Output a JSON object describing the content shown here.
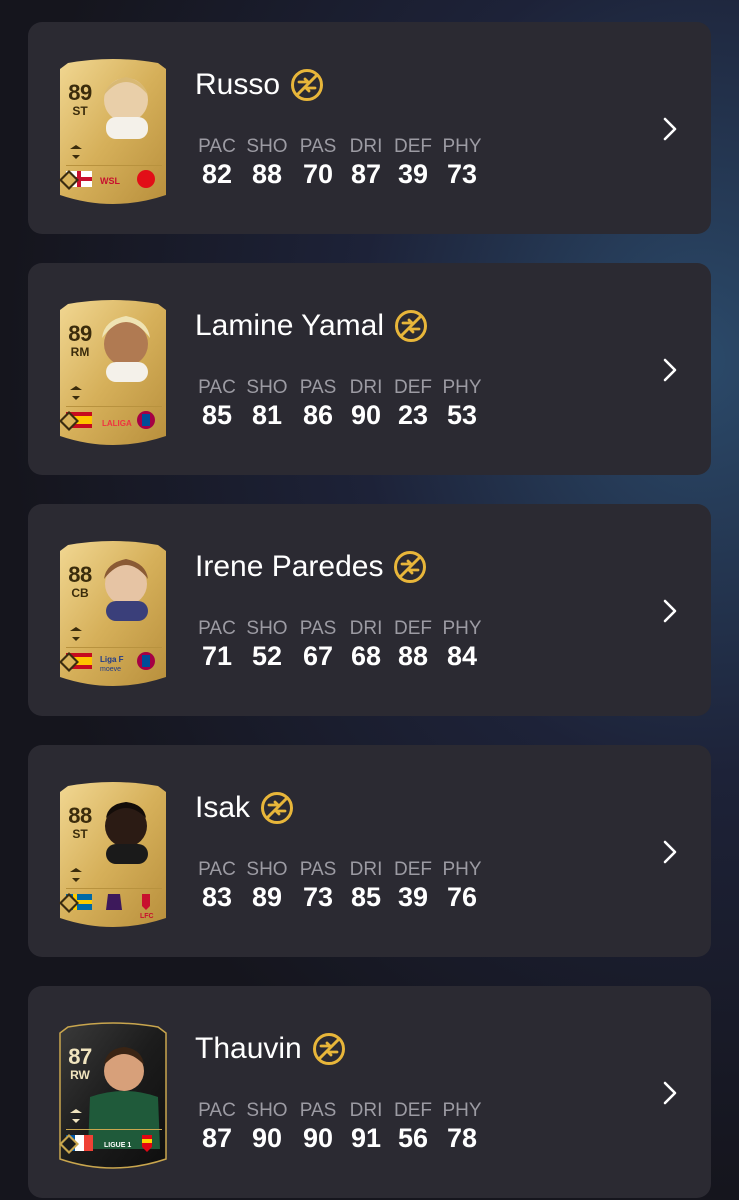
{
  "stat_labels": [
    "PAC",
    "SHO",
    "PAS",
    "DRI",
    "DEF",
    "PHY"
  ],
  "players": [
    {
      "name": "Russo",
      "rating": "89",
      "position": "ST",
      "stats": [
        "82",
        "88",
        "70",
        "87",
        "39",
        "73"
      ],
      "card": "gold",
      "nation_flag": "england-flag",
      "league_badge": "wsl-badge",
      "club_badge": "arsenal-badge"
    },
    {
      "name": "Lamine Yamal",
      "rating": "89",
      "position": "RM",
      "stats": [
        "85",
        "81",
        "86",
        "90",
        "23",
        "53"
      ],
      "card": "gold",
      "nation_flag": "spain-flag",
      "league_badge": "laliga-badge",
      "club_badge": "barcelona-badge"
    },
    {
      "name": "Irene Paredes",
      "rating": "88",
      "position": "CB",
      "stats": [
        "71",
        "52",
        "67",
        "68",
        "88",
        "84"
      ],
      "card": "gold",
      "nation_flag": "spain-flag",
      "league_badge": "liga-f-badge",
      "club_badge": "barcelona-badge"
    },
    {
      "name": "Isak",
      "rating": "88",
      "position": "ST",
      "stats": [
        "83",
        "89",
        "73",
        "85",
        "39",
        "76"
      ],
      "card": "gold",
      "nation_flag": "sweden-flag",
      "league_badge": "premier-league-badge",
      "club_badge": "liverpool-badge"
    },
    {
      "name": "Thauvin",
      "rating": "87",
      "position": "RW",
      "stats": [
        "87",
        "90",
        "90",
        "91",
        "56",
        "78"
      ],
      "card": "black",
      "nation_flag": "france-flag",
      "league_badge": "ligue1-badge",
      "club_badge": "lens-badge"
    }
  ],
  "colors": {
    "row_bg": "#2b2a32",
    "gold_card": "#d9b45c",
    "black_card": "#1c1c1c",
    "badge_gold": "#e8b63a",
    "stat_label": "#9c9ba3"
  }
}
